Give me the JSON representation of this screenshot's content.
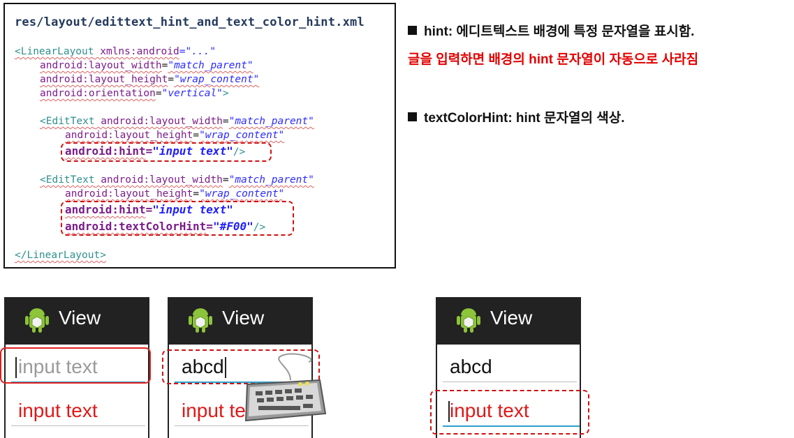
{
  "code": {
    "filename": "res/layout/edittext_hint_and_text_color_hint.xml",
    "lines": [
      {
        "t1": "<LinearLayout",
        "t2": " xmlns:android",
        "t3": "=\"...\""
      },
      {
        "a": "android:layout_width",
        "v": "\"match_parent\""
      },
      {
        "a": "android:layout_height",
        "v": "\"wrap_content\""
      },
      {
        "a": "android:orientation",
        "v": "\"vertical\"",
        "end": ">"
      },
      {
        "t1": "<EditText",
        "a": " android:layout_width",
        "v": "\"match_parent\""
      },
      {
        "a": "android:layout_height",
        "v": "\"wrap_content\""
      },
      {
        "a": "android:hint",
        "v": "\"input text\"",
        "end": "/>"
      },
      {
        "t1": "<EditText",
        "a": " android:layout_width",
        "v": "\"match_parent\""
      },
      {
        "a": "android:layout_height",
        "v": "\"wrap_content\""
      },
      {
        "a": "android:hint",
        "v": "\"input text\""
      },
      {
        "a": "android:textColorHint",
        "v": "\"#F00\"",
        "end": "/>"
      },
      {
        "t1": "</LinearLayout>"
      }
    ]
  },
  "notes": {
    "line1": "hint: 에디트텍스트 배경에 특정 문자열을 표시함.",
    "line2": "글을 입력하면 배경의 hint 문자열이 자동으로 사라짐",
    "line3": "textColorHint: hint 문자열의 색상."
  },
  "phones": [
    {
      "title": "View",
      "field1": "input text",
      "field2": "input text"
    },
    {
      "title": "View",
      "field1": "abcd",
      "field2": "input te"
    },
    {
      "title": "View",
      "field1": "abcd",
      "field2": "input text"
    }
  ],
  "colors": {
    "hint_red": "#e01818",
    "accent_blue": "#2f9ec9",
    "dash_red": "#d01010"
  }
}
